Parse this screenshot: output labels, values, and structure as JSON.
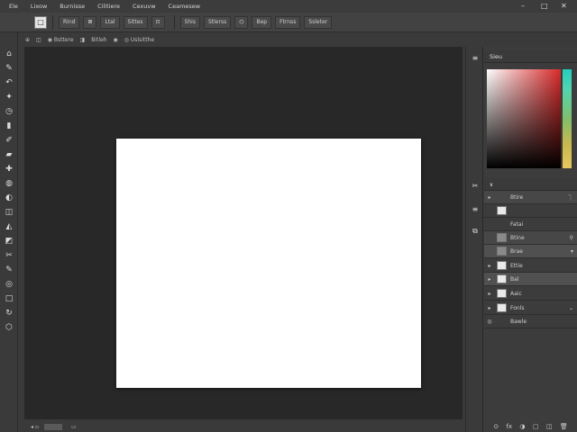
{
  "menubar": {
    "items": [
      "Ele",
      "Lixow",
      "Burnisse",
      "Cilitiere",
      "Cexuvw",
      "Ceamesew"
    ],
    "window_controls": [
      "–",
      "□",
      "✕"
    ]
  },
  "optbar": {
    "preset_glyph": "□",
    "buttons": [
      "Rind",
      "⊠",
      "Ltal",
      "Sittes",
      "⊡",
      "Shis",
      "Stlerss",
      "⌬",
      "Bep",
      "Ftrnss",
      "Ssleter"
    ]
  },
  "tabrow": {
    "items": [
      "⊕",
      "◫",
      "◉ Bsttere",
      "◨",
      "Bitleh",
      "◉",
      "◎ Uslsitthe"
    ]
  },
  "toolbar": {
    "tools": [
      "⌂",
      "✎",
      "↶",
      "✦",
      "◷",
      "▮",
      "✐",
      "▰",
      "✚",
      "◍",
      "◐",
      "◫",
      "◭",
      "◩",
      "✂",
      "✎",
      "◎",
      "□",
      "↻",
      "⬡"
    ]
  },
  "statusbar": {
    "text": "◂ ▫",
    "zoom_label": "▭"
  },
  "panel_strip": {
    "icons": [
      "≡",
      "✂",
      "≡",
      "⧉"
    ]
  },
  "color_panel": {
    "title": "Sieu"
  },
  "layers_panel": {
    "title": "ɤ",
    "rows": [
      {
        "eye": "▸",
        "name": "Btire",
        "lock": "⏋"
      },
      {
        "eye": "",
        "name": "",
        "lock": ""
      },
      {
        "eye": "",
        "name": "Fatai",
        "lock": ""
      },
      {
        "eye": "",
        "name": "Btine",
        "lock": "⚲"
      },
      {
        "eye": "",
        "name": "Brae",
        "lock": "▾"
      },
      {
        "eye": "▸",
        "name": "Ettie",
        "lock": ""
      },
      {
        "eye": "▸",
        "name": "Bal",
        "lock": ""
      },
      {
        "eye": "▸",
        "name": "Aaic",
        "lock": ""
      },
      {
        "eye": "▸",
        "name": "Fonls",
        "lock": "⌄"
      },
      {
        "eye": "◎",
        "name": "Bawle",
        "lock": ""
      }
    ],
    "footer_icons": [
      "⊙",
      "fx",
      "◑",
      "▢",
      "◫",
      "🗑"
    ]
  }
}
